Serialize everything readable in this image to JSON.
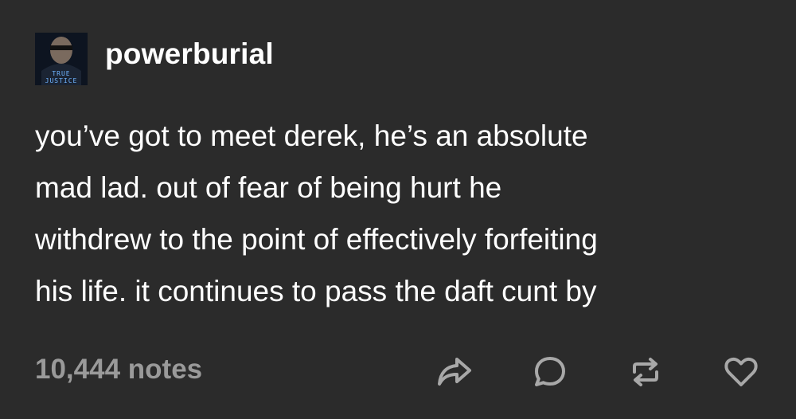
{
  "post": {
    "author": {
      "username": "powerburial",
      "avatar_text_line1": "TRUE",
      "avatar_text_line2": "JUSTICE"
    },
    "body_lines": [
      "you’ve got to meet derek, he’s an absolute",
      "mad lad. out of fear of being hurt he",
      "withdrew to the point of effectively forfeiting",
      "his life. it continues to pass the daft cunt by"
    ],
    "notes": "10,444 notes",
    "actions": [
      {
        "name": "share",
        "icon": "share-arrow-icon"
      },
      {
        "name": "reply",
        "icon": "comment-bubble-icon"
      },
      {
        "name": "reblog",
        "icon": "reblog-icon"
      },
      {
        "name": "like",
        "icon": "heart-icon"
      }
    ],
    "colors": {
      "background": "#2b2b2b",
      "text": "#ffffff",
      "notes": "#9a9a9a",
      "icon": "#a8a8a8"
    }
  }
}
